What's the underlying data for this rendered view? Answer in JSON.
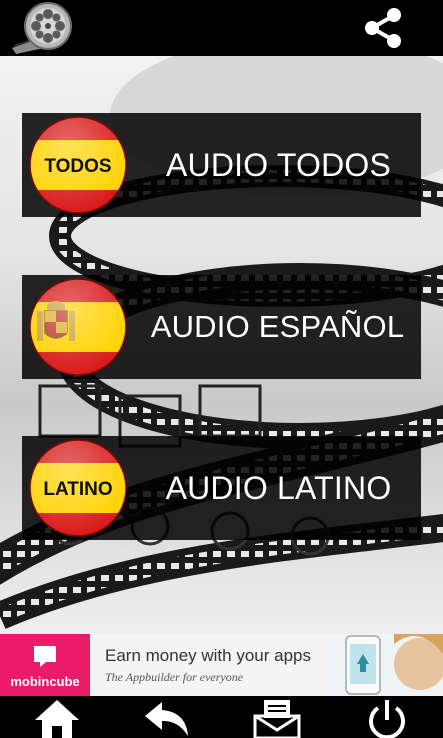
{
  "topbar": {
    "logo_icon": "film-reel-icon",
    "share_icon": "share-icon"
  },
  "menu": [
    {
      "badge_text": "TODOS",
      "badge_type": "spain-colors",
      "label": "AUDIO TODOS"
    },
    {
      "badge_text": "",
      "badge_type": "spain-flag-with-coat-of-arms",
      "label": "AUDIO ESPAÑOL"
    },
    {
      "badge_text": "LATINO",
      "badge_type": "spain-colors",
      "label": "AUDIO LATINO"
    }
  ],
  "ad": {
    "brand": "mobincube",
    "headline": "Earn money with your apps",
    "tagline": "The Appbuilder for everyone"
  },
  "bottombar": {
    "icons": [
      "home-icon",
      "back-icon",
      "mail-icon",
      "power-icon"
    ]
  },
  "colors": {
    "flag_red": "#d91a1a",
    "flag_yellow": "#ffd200",
    "ad_brand": "#ea1c6a",
    "button_bg": "#000000"
  }
}
